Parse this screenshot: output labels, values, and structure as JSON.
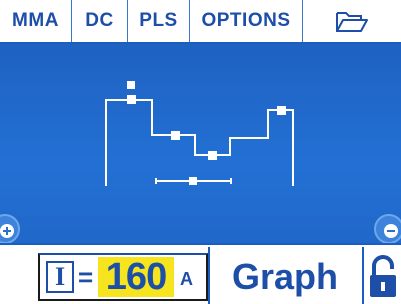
{
  "menu": {
    "items": [
      "MMA",
      "DC",
      "PLS",
      "OPTIONS"
    ],
    "folder_icon": "folder-open-icon"
  },
  "colors": {
    "accent": "#1d4fa8",
    "panel": "#1f66c8",
    "highlight": "#f6e51e",
    "line": "#ffffff"
  },
  "graph": {
    "zoom_in_icon": "zoom-in-icon",
    "zoom_out_icon": "zoom-out-icon"
  },
  "status": {
    "current_symbol": "I",
    "equals": "=",
    "current_value": "160",
    "current_unit": "A",
    "view_label": "Graph",
    "lock_icon": "lock-open-icon"
  }
}
